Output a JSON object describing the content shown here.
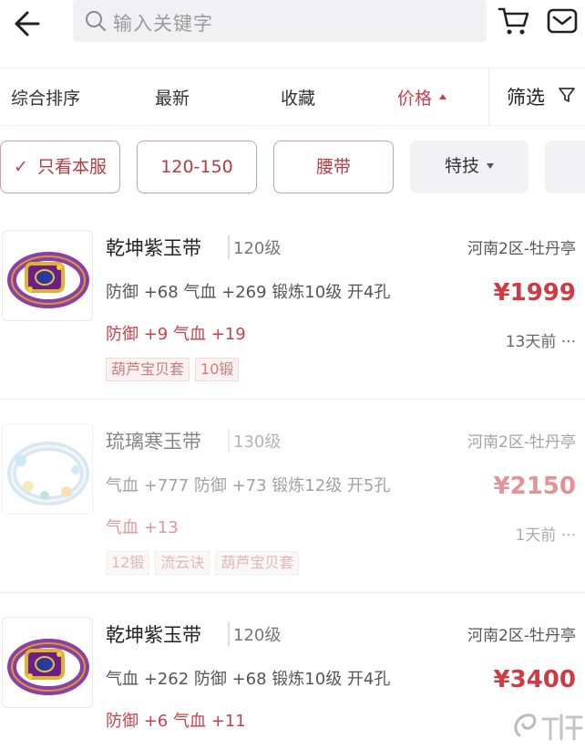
{
  "header": {
    "search_placeholder": "输入关键字"
  },
  "sort": {
    "items": [
      "综合排序",
      "最新",
      "收藏",
      "价格"
    ],
    "active": "价格",
    "filter_label": "筛选"
  },
  "chips": {
    "only_this_server": "只看本服",
    "range": "120-150",
    "category": "腰带",
    "skill": "特技"
  },
  "colors": {
    "accent": "#c8414a",
    "price": "#d03a42",
    "tag_bg": "#fbf1f1"
  },
  "items": [
    {
      "name": "乾坤紫玉带",
      "level": "120级",
      "server": "河南2区-牡丹亭",
      "attrs": "防御 +68 气血 +269 锻炼10级 开4孔",
      "special": "防御 +9 气血 +19",
      "price": "¥1999",
      "time": "13天前",
      "tags": [
        "葫芦宝贝套",
        "10锻"
      ],
      "icon": "purple-jade-belt-icon"
    },
    {
      "name": "琉璃寒玉带",
      "level": "130级",
      "server": "河南2区-牡丹亭",
      "attrs": "气血 +777 防御 +73 锻炼12级 开5孔",
      "special": "气血 +13",
      "price": "¥2150",
      "time": "1天前",
      "tags": [
        "12锻",
        "流云诀",
        "葫芦宝贝套"
      ],
      "icon": "ice-jade-belt-icon"
    },
    {
      "name": "乾坤紫玉带",
      "level": "120级",
      "server": "河南2区-牡丹亭",
      "attrs": "气血 +262 防御 +68 锻炼10级 开4孔",
      "special": "防御 +6 气血 +11",
      "price": "¥3400",
      "time": "",
      "tags": [],
      "icon": "purple-jade-belt-icon"
    }
  ]
}
